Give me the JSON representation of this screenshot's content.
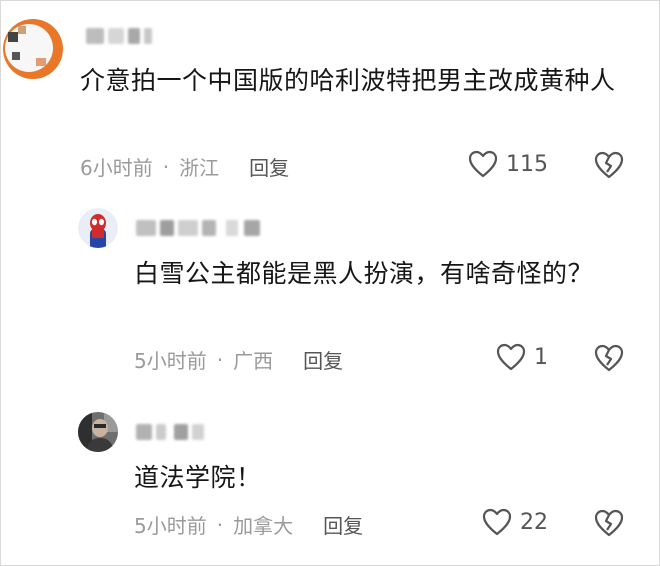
{
  "comments": [
    {
      "text": "介意拍一个中国版的哈利波特把男主改成黄种人",
      "time": "6小时前",
      "location": "浙江",
      "reply_label": "回复",
      "likes": "115",
      "avatar_icon": "cartoon-character-icon",
      "avatar_colors": [
        "#f2f2f2",
        "#e8772a"
      ]
    },
    {
      "text": "白雪公主都能是黑人扮演，有啥奇怪的？",
      "time": "5小时前",
      "location": "广西",
      "reply_label": "回复",
      "likes": "1",
      "avatar_icon": "spiderman-icon",
      "avatar_colors": [
        "#d12b2b",
        "#2546a6"
      ]
    },
    {
      "text": "道法学院！",
      "time": "5小时前",
      "location": "加拿大",
      "reply_label": "回复",
      "likes": "22",
      "avatar_icon": "person-photo-icon",
      "avatar_colors": [
        "#3a3a3a",
        "#8b8b8b"
      ]
    }
  ]
}
